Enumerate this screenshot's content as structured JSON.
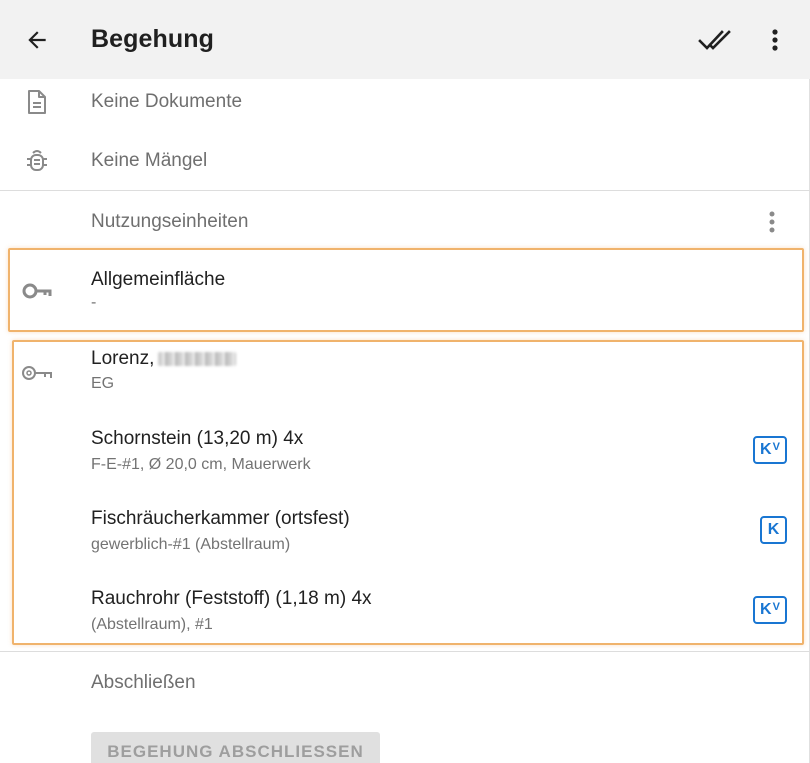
{
  "appbar": {
    "title": "Begehung",
    "back_icon": "arrow-left-icon",
    "check_icon": "double-check-icon",
    "more_icon": "more-vertical-icon"
  },
  "summary": {
    "documents_label": "Keine Dokumente",
    "defects_label": "Keine Mängel"
  },
  "section": {
    "title": "Nutzungseinheiten"
  },
  "units": [
    {
      "title": "Allgemeinfläche",
      "subtitle": "-"
    },
    {
      "title": "Lorenz,",
      "subtitle": "EG",
      "items": [
        {
          "title": "Schornstein (13,20 m) 4x",
          "subtitle": "F-E-#1, Ø 20,0 cm, Mauerwerk",
          "badge": "K",
          "badge_sup": "V"
        },
        {
          "title": "Fischräucherkammer (ortsfest)",
          "subtitle": "gewerblich-#1 (Abstellraum)",
          "badge": "K",
          "badge_sup": ""
        },
        {
          "title": "Rauchrohr (Feststoff) (1,18 m) 4x",
          "subtitle": "(Abstellraum), #1",
          "badge": "K",
          "badge_sup": "V"
        }
      ]
    }
  ],
  "finish": {
    "label": "Abschließen",
    "button_label": "BEGEHUNG ABSCHLIESSEN"
  },
  "colors": {
    "appbar_bg": "#f2f2f2",
    "highlight": "#f0b36c",
    "badge": "#1976d2",
    "icon_gray": "#8a8a8a"
  }
}
